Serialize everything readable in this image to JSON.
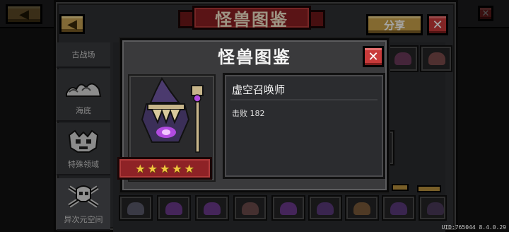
{
  "background": {
    "window_title": "图鉴",
    "banner_title": "怪兽图鉴",
    "share_label": "分享",
    "back_glyph": "◀",
    "close_glyph": "✕",
    "sidebar": [
      {
        "label": "古战场",
        "icon": "crossed-swords-icon"
      },
      {
        "label": "海底",
        "icon": "wave-icon"
      },
      {
        "label": "特殊领域",
        "icon": "demon-face-icon"
      },
      {
        "label": "异次元空间",
        "icon": "skull-crossbones-icon"
      }
    ]
  },
  "modal": {
    "title": "怪兽图鉴",
    "close_glyph": "✕",
    "monster_name": "虚空召唤师",
    "kills_text": "击败 182",
    "stars": [
      "★",
      "★",
      "★",
      "★",
      "★"
    ],
    "portrait_icon": "void-summoner-portrait-icon"
  },
  "footer": {
    "uid_text": "UID:765044 8.4.0.29"
  },
  "colors": {
    "banner_red": "#8b1f22",
    "gold_button": "#c9a24b",
    "close_red": "#c83a3a",
    "star_gold": "#f2c640",
    "purple_glow": "#b24be0"
  }
}
